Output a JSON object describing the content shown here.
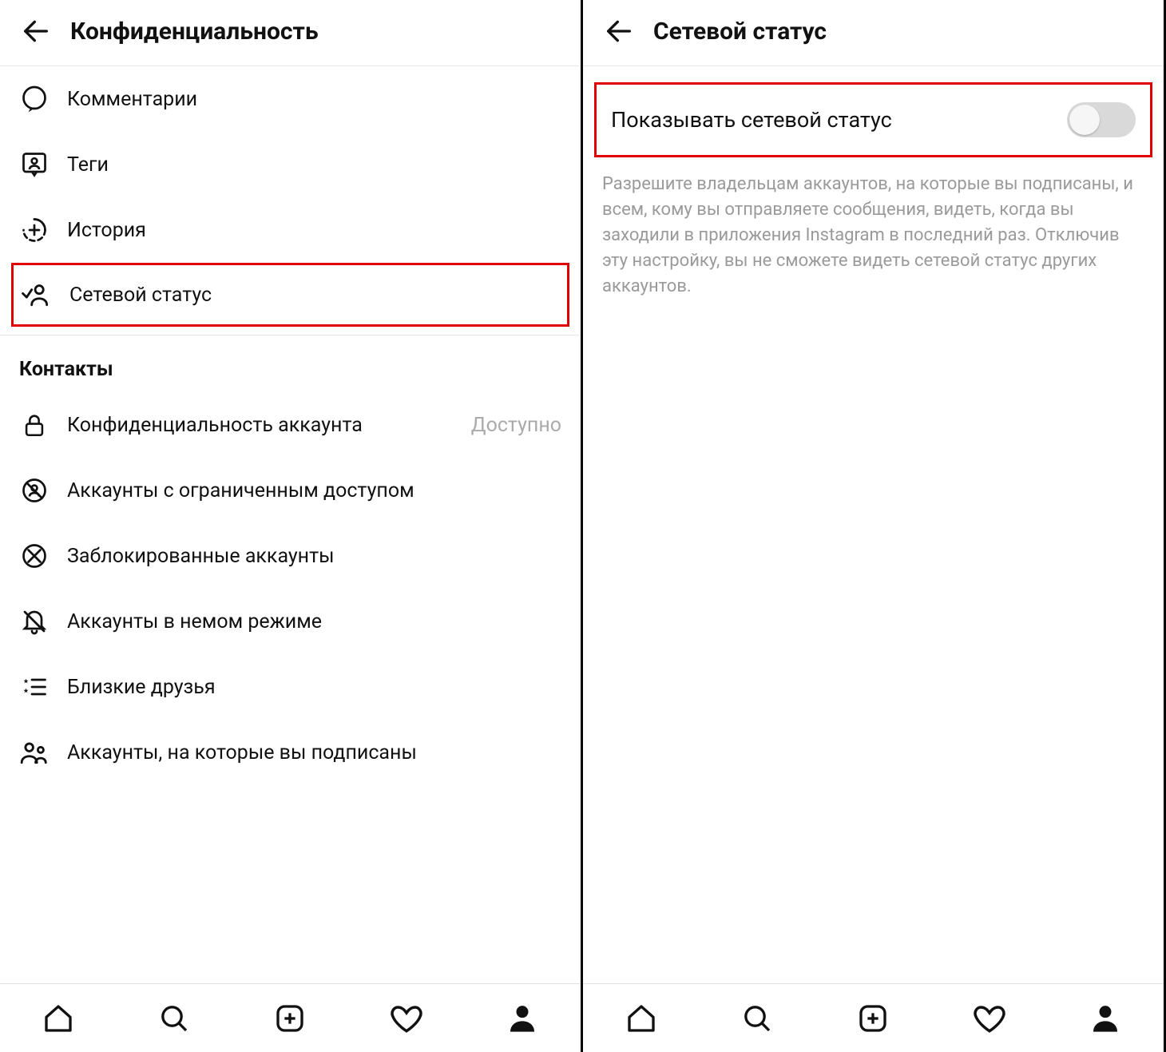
{
  "left": {
    "title": "Конфиденциальность",
    "items": {
      "comments": "Комментарии",
      "tags": "Теги",
      "story": "История",
      "activity_status": "Сетевой статус"
    },
    "section_contacts": "Контакты",
    "contacts": {
      "account_privacy": "Конфиденциальность аккаунта",
      "account_privacy_trail": "Доступно",
      "restricted": "Аккаунты с ограниченным доступом",
      "blocked": "Заблокированные аккаунты",
      "muted": "Аккаунты в немом режиме",
      "close_friends": "Близкие друзья",
      "following": "Аккаунты, на которые вы подписаны"
    }
  },
  "right": {
    "title": "Сетевой статус",
    "toggle_label": "Показывать сетевой статус",
    "helper": "Разрешите владельцам аккаунтов, на которые вы подписаны, и всем, кому вы отправляете сообщения, видеть, когда вы заходили в приложения Instagram в последний раз. Отключив эту настройку, вы не сможете видеть сетевой статус других аккаунтов."
  }
}
